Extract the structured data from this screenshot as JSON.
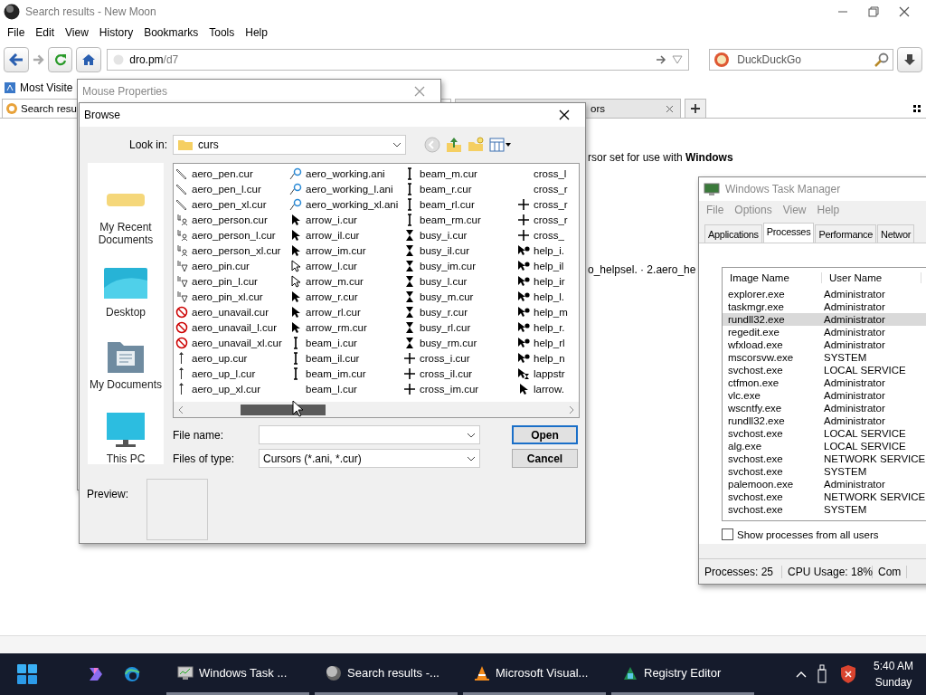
{
  "browser": {
    "title": "Search results - New Moon",
    "menu": [
      "File",
      "Edit",
      "View",
      "History",
      "Bookmarks",
      "Tools",
      "Help"
    ],
    "url_host": "dro.pm",
    "url_path": "/d7",
    "search_placeholder": "DuckDuckGo",
    "bookmarks": [
      "Most Visite"
    ],
    "tabs": [
      {
        "label": "Search resu",
        "selected": true
      },
      {
        "label": "ors",
        "selected": false
      }
    ],
    "content": [
      "rsor set for use with **Windows**",
      "o_helpsel. · 2.aero_he"
    ]
  },
  "mouse_properties": {
    "title": "Mouse Properties"
  },
  "browse": {
    "title": "Browse",
    "look_in_label": "Look in:",
    "look_in": "curs",
    "places": [
      {
        "label": "My Recent Documents",
        "kind": "recent"
      },
      {
        "label": "Desktop",
        "kind": "desktop"
      },
      {
        "label": "My Documents",
        "kind": "documents"
      },
      {
        "label": "This PC",
        "kind": "pc"
      }
    ],
    "files": [
      {
        "name": "aero_pen.cur",
        "kind": "pen"
      },
      {
        "name": "aero_pen_l.cur",
        "kind": "pen"
      },
      {
        "name": "aero_pen_xl.cur",
        "kind": "pen"
      },
      {
        "name": "aero_person.cur",
        "kind": "person"
      },
      {
        "name": "aero_person_l.cur",
        "kind": "person"
      },
      {
        "name": "aero_person_xl.cur",
        "kind": "person"
      },
      {
        "name": "aero_pin.cur",
        "kind": "pin"
      },
      {
        "name": "aero_pin_l.cur",
        "kind": "pin"
      },
      {
        "name": "aero_pin_xl.cur",
        "kind": "pin"
      },
      {
        "name": "aero_unavail.cur",
        "kind": "unavail"
      },
      {
        "name": "aero_unavail_l.cur",
        "kind": "unavail"
      },
      {
        "name": "aero_unavail_xl.cur",
        "kind": "unavail"
      },
      {
        "name": "aero_up.cur",
        "kind": "up"
      },
      {
        "name": "aero_up_l.cur",
        "kind": "up"
      },
      {
        "name": "aero_up_xl.cur",
        "kind": "up"
      },
      {
        "name": "aero_working.ani",
        "kind": "working"
      },
      {
        "name": "aero_working_l.ani",
        "kind": "working"
      },
      {
        "name": "aero_working_xl.ani",
        "kind": "working"
      },
      {
        "name": "arrow_i.cur",
        "kind": "arrow"
      },
      {
        "name": "arrow_il.cur",
        "kind": "arrow"
      },
      {
        "name": "arrow_im.cur",
        "kind": "arrow"
      },
      {
        "name": "arrow_l.cur",
        "kind": "arrow-outline"
      },
      {
        "name": "arrow_m.cur",
        "kind": "arrow-outline"
      },
      {
        "name": "arrow_r.cur",
        "kind": "arrow"
      },
      {
        "name": "arrow_rl.cur",
        "kind": "arrow"
      },
      {
        "name": "arrow_rm.cur",
        "kind": "arrow"
      },
      {
        "name": "beam_i.cur",
        "kind": "beam"
      },
      {
        "name": "beam_il.cur",
        "kind": "beam"
      },
      {
        "name": "beam_im.cur",
        "kind": "beam"
      },
      {
        "name": "beam_l.cur",
        "kind": "none"
      },
      {
        "name": "beam_m.cur",
        "kind": "beam"
      },
      {
        "name": "beam_r.cur",
        "kind": "beam"
      },
      {
        "name": "beam_rl.cur",
        "kind": "beam"
      },
      {
        "name": "beam_rm.cur",
        "kind": "beam"
      },
      {
        "name": "busy_i.cur",
        "kind": "busy"
      },
      {
        "name": "busy_il.cur",
        "kind": "busy"
      },
      {
        "name": "busy_im.cur",
        "kind": "busy"
      },
      {
        "name": "busy_l.cur",
        "kind": "busy"
      },
      {
        "name": "busy_m.cur",
        "kind": "busy"
      },
      {
        "name": "busy_r.cur",
        "kind": "busy"
      },
      {
        "name": "busy_rl.cur",
        "kind": "busy"
      },
      {
        "name": "busy_rm.cur",
        "kind": "busy"
      },
      {
        "name": "cross_i.cur",
        "kind": "cross"
      },
      {
        "name": "cross_il.cur",
        "kind": "cross"
      },
      {
        "name": "cross_im.cur",
        "kind": "cross"
      },
      {
        "name": "cross_l",
        "kind": "none"
      },
      {
        "name": "cross_r",
        "kind": "none"
      },
      {
        "name": "cross_r",
        "kind": "cross"
      },
      {
        "name": "cross_r",
        "kind": "cross"
      },
      {
        "name": "cross_",
        "kind": "cross"
      },
      {
        "name": "help_i.",
        "kind": "help"
      },
      {
        "name": "help_il",
        "kind": "help"
      },
      {
        "name": "help_ir",
        "kind": "help"
      },
      {
        "name": "help_l.",
        "kind": "help"
      },
      {
        "name": "help_m",
        "kind": "help"
      },
      {
        "name": "help_r.",
        "kind": "help"
      },
      {
        "name": "help_rl",
        "kind": "help"
      },
      {
        "name": "help_n",
        "kind": "help"
      },
      {
        "name": "lappstr",
        "kind": "appstarting"
      },
      {
        "name": "larrow.",
        "kind": "arrow"
      }
    ],
    "file_name_label": "File name:",
    "file_type_label": "Files of type:",
    "file_type": "Cursors (*.ani, *.cur)",
    "buttons": [
      {
        "label": "Open",
        "default": true
      },
      {
        "label": "Cancel",
        "default": false
      }
    ],
    "preview_label": "Preview:"
  },
  "task_manager": {
    "title": "Windows Task Manager",
    "menu": [
      "File",
      "Options",
      "View",
      "Help"
    ],
    "tabs": [
      {
        "label": "Applications",
        "selected": false
      },
      {
        "label": "Processes",
        "selected": true
      },
      {
        "label": "Performance",
        "selected": false
      },
      {
        "label": "Networ",
        "selected": false
      }
    ],
    "columns": [
      "Image Name",
      "User Name"
    ],
    "rows": [
      {
        "image": "explorer.exe",
        "user": "Administrator",
        "selected": false
      },
      {
        "image": "taskmgr.exe",
        "user": "Administrator",
        "selected": false
      },
      {
        "image": "rundll32.exe",
        "user": "Administrator",
        "selected": true
      },
      {
        "image": "regedit.exe",
        "user": "Administrator",
        "selected": false
      },
      {
        "image": "wfxload.exe",
        "user": "Administrator",
        "selected": false
      },
      {
        "image": "mscorsvw.exe",
        "user": "SYSTEM",
        "selected": false
      },
      {
        "image": "svchost.exe",
        "user": "LOCAL SERVICE",
        "selected": false
      },
      {
        "image": "ctfmon.exe",
        "user": "Administrator",
        "selected": false
      },
      {
        "image": "vlc.exe",
        "user": "Administrator",
        "selected": false
      },
      {
        "image": "wscntfy.exe",
        "user": "Administrator",
        "selected": false
      },
      {
        "image": "rundll32.exe",
        "user": "Administrator",
        "selected": false
      },
      {
        "image": "svchost.exe",
        "user": "LOCAL SERVICE",
        "selected": false
      },
      {
        "image": "alg.exe",
        "user": "LOCAL SERVICE",
        "selected": false
      },
      {
        "image": "svchost.exe",
        "user": "NETWORK SERVICE",
        "selected": false
      },
      {
        "image": "svchost.exe",
        "user": "SYSTEM",
        "selected": false
      },
      {
        "image": "palemoon.exe",
        "user": "Administrator",
        "selected": false
      },
      {
        "image": "svchost.exe",
        "user": "NETWORK SERVICE",
        "selected": false
      },
      {
        "image": "svchost.exe",
        "user": "SYSTEM",
        "selected": false
      }
    ],
    "show_all": {
      "label": "Show processes from all users",
      "checked": false
    },
    "status": [
      "Processes: 25",
      "CPU Usage: 18%",
      "Com"
    ]
  },
  "taskbar": {
    "tasks": [
      {
        "label": "Windows Task ...",
        "kind": "monitor"
      },
      {
        "label": "Search results -...",
        "kind": "moon"
      },
      {
        "label": "Microsoft Visual...",
        "kind": "cone"
      },
      {
        "label": "Registry Editor",
        "kind": "registry"
      }
    ],
    "time": "5:40 AM",
    "day": "Sunday"
  }
}
